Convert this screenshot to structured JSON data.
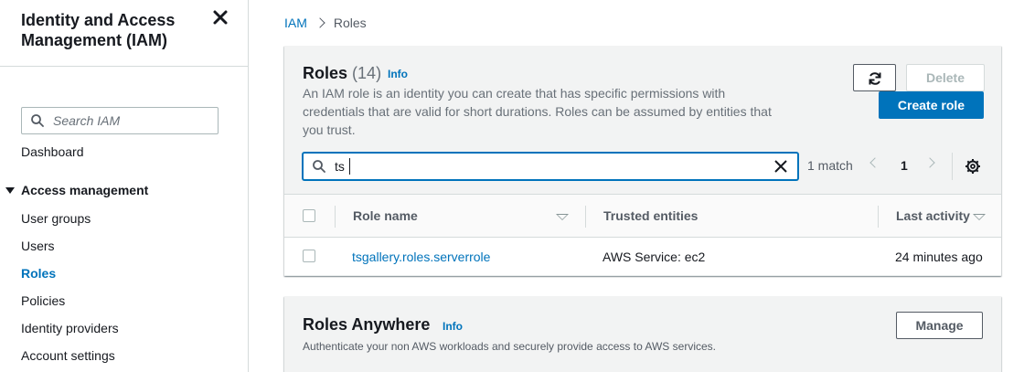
{
  "sidebar": {
    "title": "Identity and Access Management (IAM)",
    "search_placeholder": "Search IAM",
    "dashboard": "Dashboard",
    "section_label": "Access management",
    "items": [
      {
        "label": "User groups"
      },
      {
        "label": "Users"
      },
      {
        "label": "Roles"
      },
      {
        "label": "Policies"
      },
      {
        "label": "Identity providers"
      },
      {
        "label": "Account settings"
      }
    ],
    "active_item": "Roles"
  },
  "breadcrumb": {
    "root": "IAM",
    "current": "Roles"
  },
  "roles_panel": {
    "title": "Roles",
    "count": "(14)",
    "info": "Info",
    "description": "An IAM role is an identity you can create that has specific permissions with credentials that are valid for short durations. Roles can be assumed by entities that you trust.",
    "delete_label": "Delete",
    "create_label": "Create role",
    "filter_value": "ts",
    "match_text": "1 match",
    "page_number": "1",
    "columns": {
      "role_name": "Role name",
      "trusted_entities": "Trusted entities",
      "last_activity": "Last activity"
    },
    "rows": [
      {
        "role_name": "tsgallery.roles.serverrole",
        "trusted_entities": "AWS Service: ec2",
        "last_activity": "24 minutes ago"
      }
    ]
  },
  "roles_anywhere": {
    "title": "Roles Anywhere",
    "info": "Info",
    "description": "Authenticate your non AWS workloads and securely provide access to AWS services.",
    "manage_label": "Manage"
  },
  "colors": {
    "link": "#0073bb",
    "primary_button": "#0073bb",
    "header_bg": "#f2f3f3"
  },
  "icons": [
    "close-icon",
    "search-icon",
    "refresh-icon",
    "clear-icon",
    "chevron-left-icon",
    "chevron-right-icon",
    "gear-icon",
    "sort-icon",
    "caret-down-icon"
  ]
}
